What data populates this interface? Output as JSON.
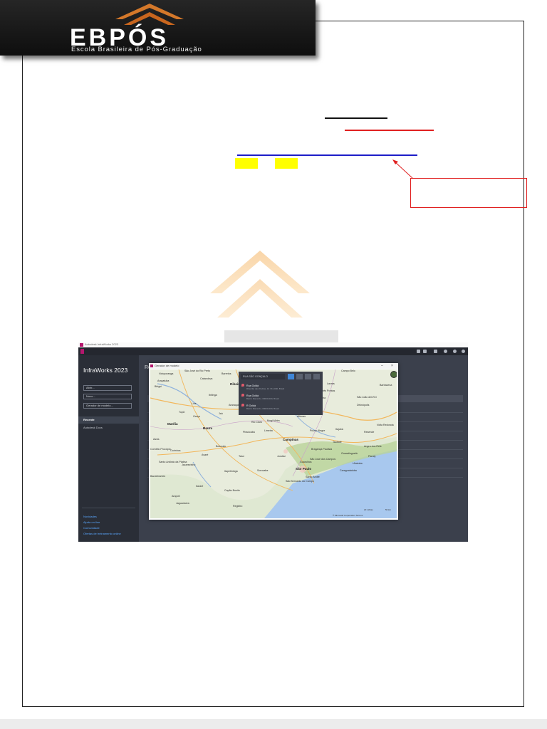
{
  "logo": {
    "name": "EBPÓS",
    "tagline": "Escola Brasileira de Pós-Graduação",
    "colors": {
      "roof": "#d4782a",
      "banner": "#1a1a1a",
      "text": "#ffffff"
    }
  },
  "annotations": {
    "colors": {
      "black_line": "#111111",
      "red_line": "#e02020",
      "blue_line": "#1d1dc8",
      "highlight": "#ffff00",
      "box": "#e02020"
    }
  },
  "screenshot": {
    "window_title": "Autodesk InfraWorks 2023",
    "product": "InfraWorks 2023",
    "sidebar": {
      "buttons": [
        "Abrir...",
        "Novo...",
        "Gerador de modelo..."
      ],
      "recent_header": "Recente",
      "recent_items": [
        "Autodesk Docs"
      ],
      "links": [
        "Novidades",
        "Ajuda on-line",
        "Comunidade",
        "Ofertas de treinamento online"
      ]
    },
    "main_header": "Re",
    "dialog": {
      "title": "Gerador de modelo",
      "search": {
        "query": "RUA SÃO GONÇALO",
        "results": [
          {
            "name": "Rua Ocidá",
            "detail": "Ribeirão das Pedras, 13 741-000, Brasil"
          },
          {
            "name": "Rua Ocidá",
            "detail": "Bairro Marumbi, 30000-000, Brasil"
          },
          {
            "name": "R Ocidá",
            "detail": "Bairro Marumbi, 30000-000, Brasil"
          }
        ]
      },
      "map_labels": [
        "São José do Rio Preto",
        "Catanduva",
        "Araçatuba",
        "Birigui",
        "Barretos",
        "Ribeirão Preto",
        "Franca",
        "Campo Belo",
        "São João del-Rei",
        "Lavras",
        "Barbacena",
        "Três Pontas",
        "Varginha",
        "Poços de Caldas",
        "Marília",
        "Bauru",
        "Araraquara",
        "São Carlos",
        "Piracicaba",
        "Campinas",
        "Sorocaba",
        "São Paulo",
        "Ourinhos",
        "Assis",
        "Itapetininga",
        "Avaré",
        "Botucatu",
        "Bragança Paulista",
        "Taubaté",
        "São José dos Campos",
        "Jundiaí",
        "Guarulhos",
        "Santo André",
        "São Bernardo do Campo",
        "Resende",
        "Volta Redonda",
        "Angra dos Reis",
        "Registro",
        "Santo Antônio da Platina",
        "Jacarezinho",
        "Capão Bonito",
        "Itararé",
        "Arapoti",
        "Jaguariaíva",
        "Pouso Alegre",
        "Itajubá",
        "Guaratinguetá",
        "Caraguatatuba",
        "Ubatuba",
        "Paraty",
        "Mogi Mirim",
        "Limeira",
        "Rio Claro",
        "Votuporanga",
        "Lins",
        "Jaú",
        "Ibitinga",
        "Bebedouro",
        "Passos",
        "São Sebastião do Paraíso",
        "Alfenas",
        "Divinópolis",
        "Tatuí",
        "Bandeirantes",
        "Cornélio Procópio",
        "Jaboticabal",
        "Garça",
        "Tupã"
      ],
      "attribution": "© Microsoft Corporation  Termos",
      "scale": [
        "20 milhas",
        "50 km"
      ]
    }
  }
}
